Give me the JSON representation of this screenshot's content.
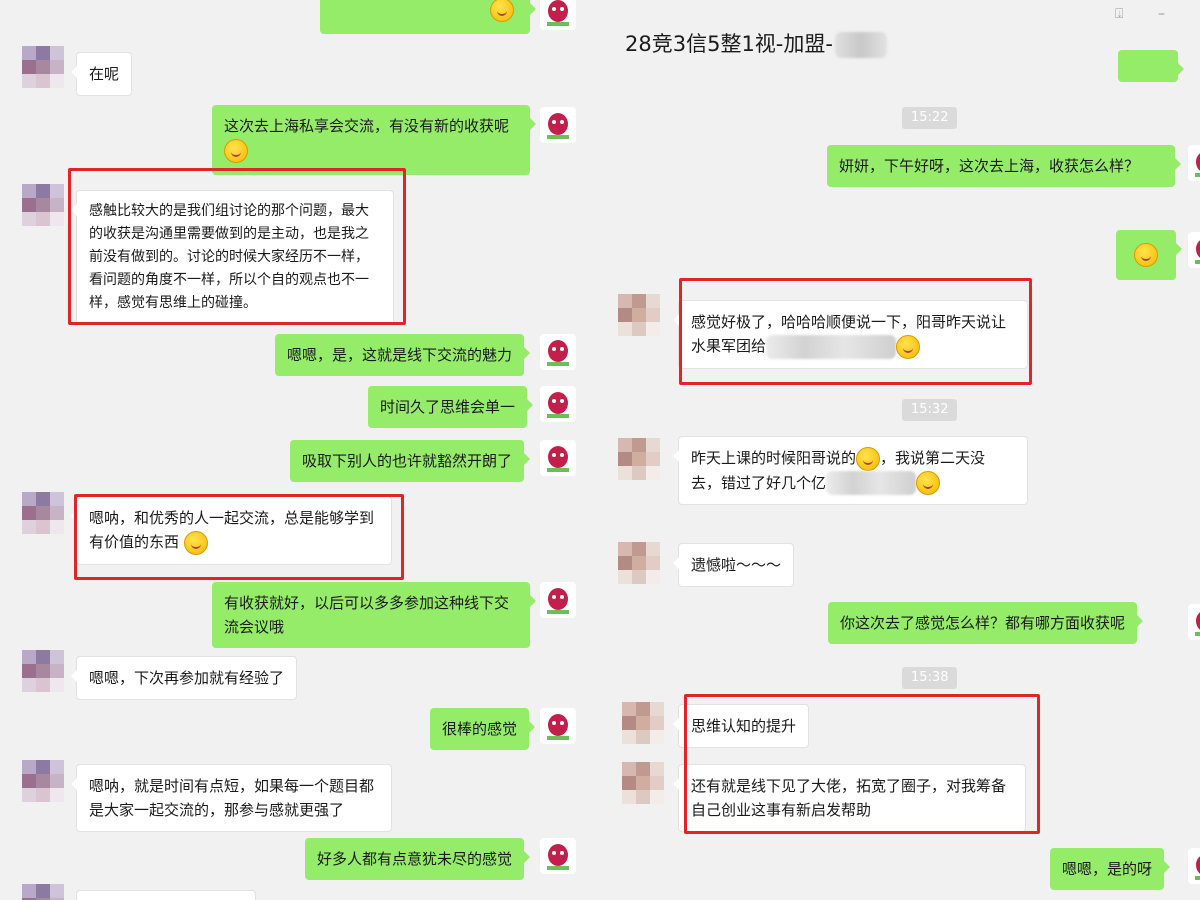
{
  "left_chat": {
    "messages": [
      {
        "text": "在呢"
      },
      {
        "text": "这次去上海私享会交流，有没有新的收获呢"
      },
      {
        "text": "感触比较大的是我们组讨论的那个问题，最大的收获是沟通里需要做到的是主动，也是我之前没有做到的。讨论的时候大家经历不一样，看问题的角度不一样，所以个自的观点也不一样，感觉有思维上的碰撞。"
      },
      {
        "text": "嗯嗯，是，这就是线下交流的魅力"
      },
      {
        "text": "时间久了思维会单一"
      },
      {
        "text": "吸取下别人的也许就豁然开朗了"
      },
      {
        "text": "嗯呐，和优秀的人一起交流，总是能够学到有价值的东西"
      },
      {
        "text": "有收获就好，以后可以多多参加这种线下交流会议哦"
      },
      {
        "text": "嗯嗯，下次再参加就有经验了"
      },
      {
        "text": "很棒的感觉"
      },
      {
        "text": "嗯呐，就是时间有点短，如果每一个题目都是大家一起交流的，那参与感就更强了"
      },
      {
        "text": "好多人都有点意犹未尽的感觉"
      }
    ]
  },
  "right_chat": {
    "title": "28竞3信5整1视-加盟-",
    "window_buttons": {
      "pin": "⍗",
      "minimize": "–"
    },
    "timestamps": [
      "15:22",
      "15:32",
      "15:38"
    ],
    "messages": [
      {
        "text": "妍妍，下午好呀，这次去上海，收获怎么样？"
      },
      {
        "text": "感觉好极了，哈哈哈顺便说一下，阳哥昨天说让水果军团给"
      },
      {
        "text": "昨天上课的时候阳哥说的"
      },
      {
        "text": "，我说第二天没去，错过了好几个亿"
      },
      {
        "text": "遗憾啦～～～"
      },
      {
        "text": "你这次去了感觉怎么样？都有哪方面收获呢"
      },
      {
        "text": "思维认知的提升"
      },
      {
        "text": "还有就是线下见了大佬，拓宽了圈子，对我筹备自己创业这事有新启发帮助"
      },
      {
        "text": "嗯嗯，是的呀"
      }
    ]
  },
  "colors": {
    "outgoing_bubble": "#95ec69",
    "incoming_bubble": "#ffffff",
    "highlight": "#e02525",
    "timestamp_bg": "#dadada",
    "background": "#f1f1f1"
  }
}
